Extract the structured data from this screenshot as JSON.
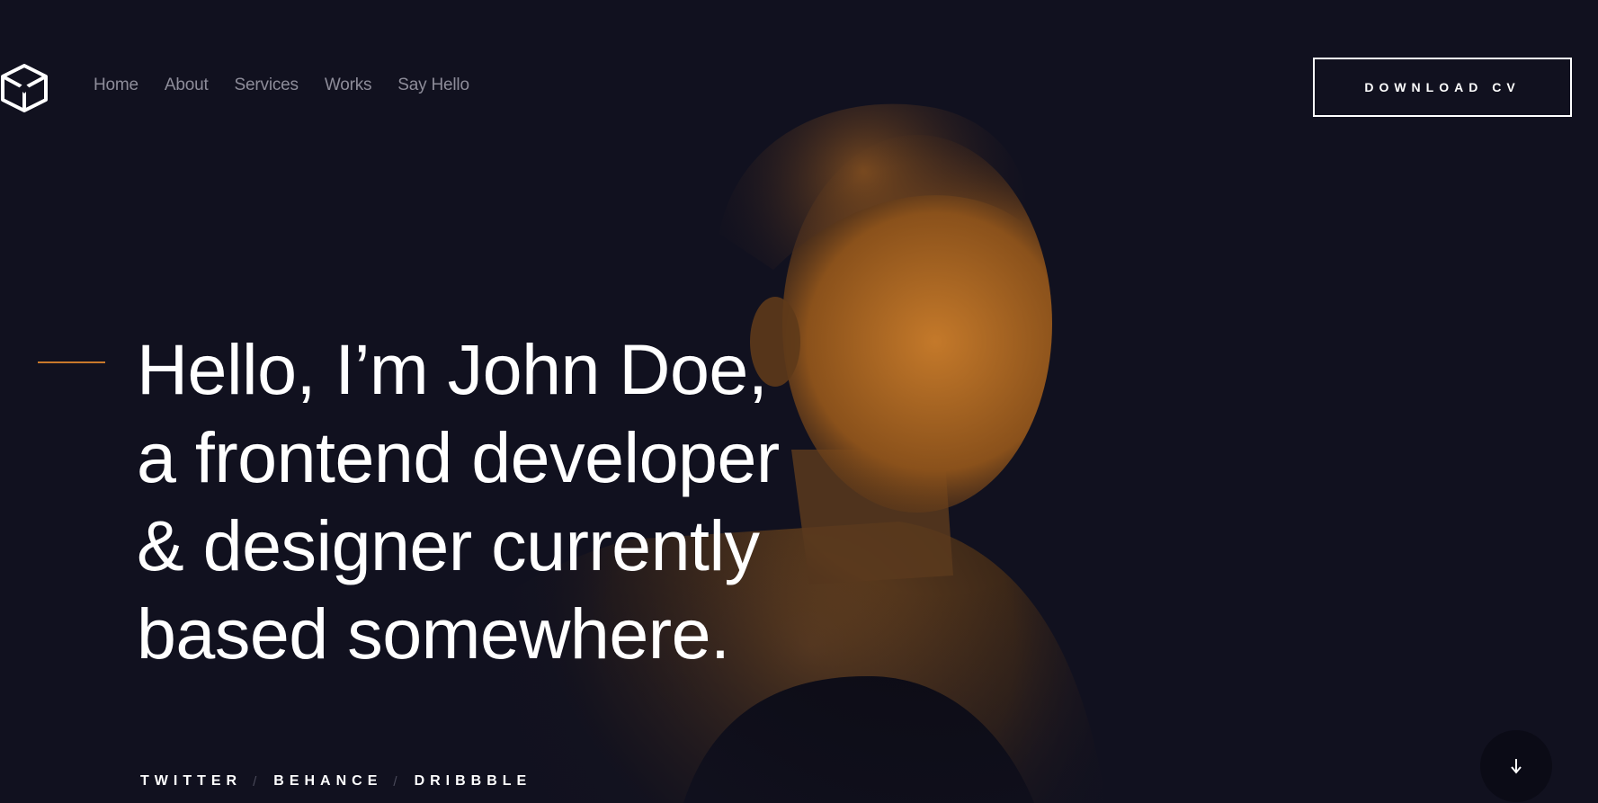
{
  "brand": {
    "logo_icon": "cube-logo-icon"
  },
  "nav": {
    "items": [
      {
        "label": "Home"
      },
      {
        "label": "About"
      },
      {
        "label": "Services"
      },
      {
        "label": "Works"
      },
      {
        "label": "Say Hello"
      }
    ]
  },
  "header": {
    "cta_label": "DOWNLOAD CV"
  },
  "hero": {
    "lines": [
      "Hello, I’m John Doe,",
      "a frontend developer",
      "& designer currently",
      "based somewhere."
    ]
  },
  "social": {
    "links": [
      "TWITTER",
      "BEHANCE",
      "DRIBBBLE"
    ],
    "separator": "/"
  },
  "scroll": {
    "icon": "arrow-down-icon"
  },
  "colors": {
    "background": "#11111f",
    "accent": "#c9782b",
    "text": "#ffffff",
    "nav_text": "#8d8c99"
  }
}
